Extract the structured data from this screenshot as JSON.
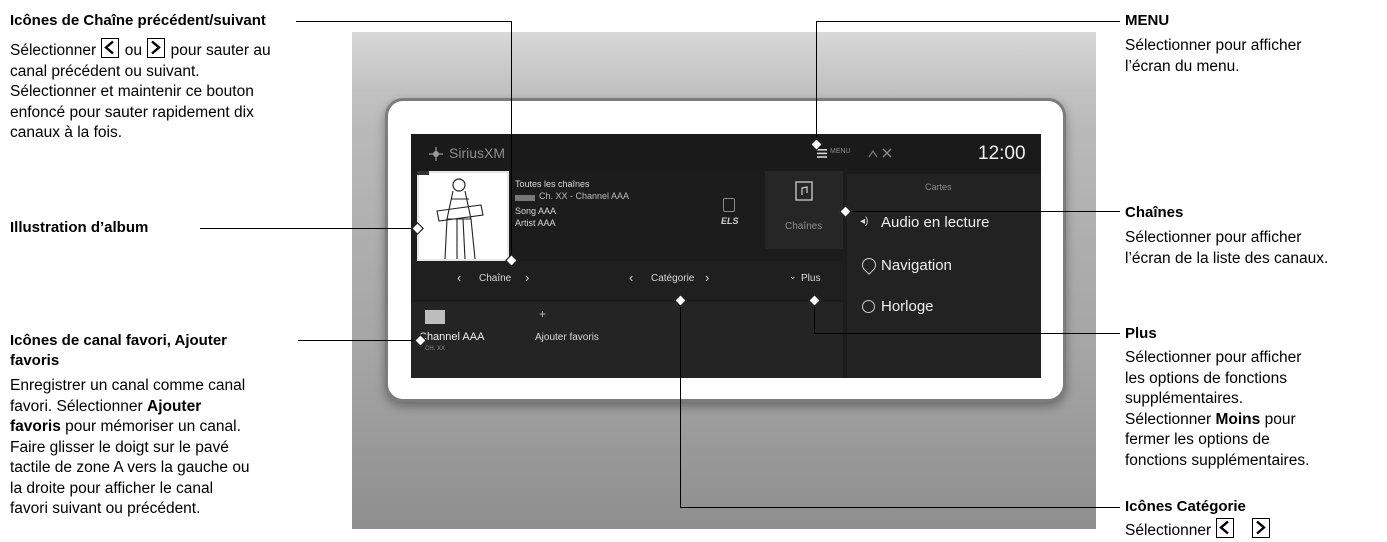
{
  "annotations": {
    "prev_next": {
      "title": "Icônes de Chaîne précédent/suivant",
      "line1_pre": "Sélectionner",
      "line1_mid": "ou",
      "line1_post": "pour sauter au",
      "line2": "canal précédent ou suivant.",
      "line3": "Sélectionner et maintenir ce bouton",
      "line4": "enfoncé pour sauter rapidement dix",
      "line5": "canaux à la fois."
    },
    "album_art": {
      "title": "Illustration d’album"
    },
    "favorites": {
      "title_line1": "Icônes de canal favori, Ajouter",
      "title_line2": "favoris",
      "line1": "Enregistrer un canal comme canal",
      "line2_pre": "favori. Sélectionner",
      "line2_bold": "Ajouter",
      "line3_bold": "favoris",
      "line3_post": "pour mémoriser un canal.",
      "line4": "Faire glisser le doigt sur le pavé",
      "line5": "tactile de zone A vers la gauche ou",
      "line6": "la droite pour afficher le canal",
      "line7": "favori suivant ou précédent."
    },
    "menu": {
      "title": "MENU",
      "line1": "Sélectionner pour afficher",
      "line2": "l’écran du menu."
    },
    "channels": {
      "title": "Chaînes",
      "line1": "Sélectionner pour afficher",
      "line2": "l’écran de la liste des canaux."
    },
    "plus": {
      "title": "Plus",
      "line1": "Sélectionner pour afficher",
      "line2": "les options de fonctions",
      "line3": "supplémentaires.",
      "line4_pre": "Sélectionner",
      "line4_bold": "Moins",
      "line4_post": "pour",
      "line5": "fermer les options de",
      "line6": "fonctions supplémentaires."
    },
    "category": {
      "title": "Icônes Catégorie",
      "line1_pre": "Sélectionner"
    }
  },
  "screen": {
    "brand": "SiriusXM",
    "menu_label": "MENU",
    "clock": "12:00",
    "all_channels": "Toutes les chaînes",
    "channel_line": "Ch. XX - Channel AAA",
    "song": "Song AAA",
    "artist": "Artist AAA",
    "els_badge": "ELS",
    "channels_button": "Chaînes",
    "chain_label": "Chaîne",
    "category_label": "Catégorie",
    "plus_label": "Plus",
    "favorite_channel": "Channel AAA",
    "favorite_sub": "CH. XX",
    "add_favorites": "Ajouter favoris",
    "side_menu": {
      "maps": "Cartes",
      "audio": "Audio en lecture",
      "navigation": "Navigation",
      "clock": "Horloge"
    }
  }
}
